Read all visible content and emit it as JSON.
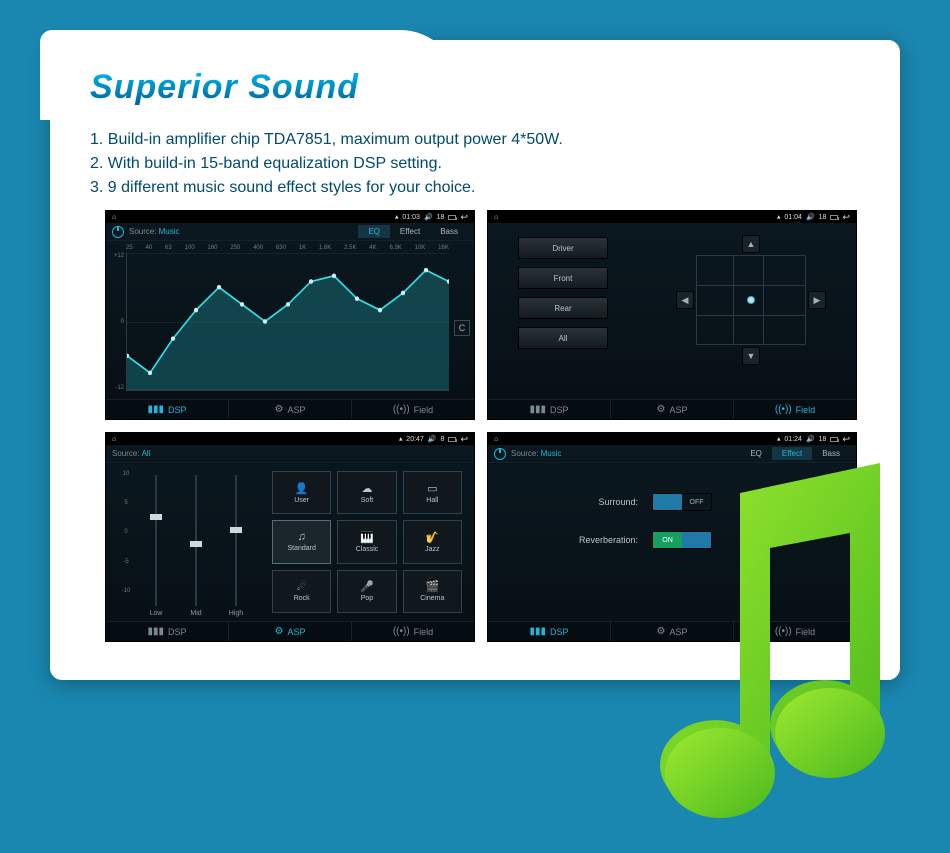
{
  "title": "Superior Sound",
  "desc_lines": [
    "1. Build-in amplifier chip TDA7851, maximum output power 4*50W.",
    "2. With build-in 15-band equalization DSP setting.",
    "3. 9 different music sound effect styles for your choice."
  ],
  "bottombar": {
    "dsp": "DSP",
    "asp": "ASP",
    "field": "Field"
  },
  "source_label": "Source:",
  "screens": {
    "eq": {
      "status": {
        "time": "01:03",
        "vol": "18"
      },
      "source": "Music",
      "tabs": {
        "eq": "EQ",
        "effect": "Effect",
        "bass": "Bass",
        "active": "eq"
      },
      "active_bottom": "dsp",
      "reset": "C",
      "chart_data": {
        "type": "line",
        "categories": [
          "25",
          "40",
          "63",
          "100",
          "160",
          "250",
          "400",
          "630",
          "1K",
          "1.6K",
          "2.5K",
          "4K",
          "6.3K",
          "10K",
          "16K"
        ],
        "values": [
          -6,
          -9,
          -3,
          2,
          6,
          3,
          0,
          3,
          7,
          8,
          4,
          2,
          5,
          9,
          7
        ],
        "ylim": [
          -12,
          12
        ],
        "yticks": [
          "+12",
          "0",
          "-12"
        ],
        "title": "",
        "xlabel": "",
        "ylabel": ""
      }
    },
    "field": {
      "status": {
        "time": "01:04",
        "vol": "18"
      },
      "active_bottom": "field",
      "buttons": [
        "Driver",
        "Front",
        "Rear",
        "All"
      ]
    },
    "asp": {
      "status": {
        "time": "20:47",
        "vol": "8"
      },
      "source": "All",
      "active_bottom": "asp",
      "slider_scale": [
        "10",
        "5",
        "0",
        "-5",
        "-10"
      ],
      "sliders": [
        {
          "label": "Low",
          "value": 4
        },
        {
          "label": "Mid",
          "value": 0
        },
        {
          "label": "High",
          "value": 2
        }
      ],
      "presets": [
        {
          "label": "User",
          "icon": "👤"
        },
        {
          "label": "Soft",
          "icon": "☁"
        },
        {
          "label": "Hall",
          "icon": "▭"
        },
        {
          "label": "Standard",
          "icon": "♫",
          "selected": true
        },
        {
          "label": "Classic",
          "icon": "🎹"
        },
        {
          "label": "Jazz",
          "icon": "🎷"
        },
        {
          "label": "Rock",
          "icon": "☄"
        },
        {
          "label": "Pop",
          "icon": "🎤"
        },
        {
          "label": "Cinema",
          "icon": "🎬"
        }
      ]
    },
    "effect": {
      "status": {
        "time": "01:24",
        "vol": "18"
      },
      "source": "Music",
      "tabs": {
        "eq": "EQ",
        "effect": "Effect",
        "bass": "Bass",
        "active": "effect"
      },
      "active_bottom": "dsp",
      "rows": {
        "surround": {
          "label": "Surround:",
          "state": "OFF"
        },
        "reverberation": {
          "label": "Reverberation:",
          "state": "ON"
        }
      }
    }
  }
}
